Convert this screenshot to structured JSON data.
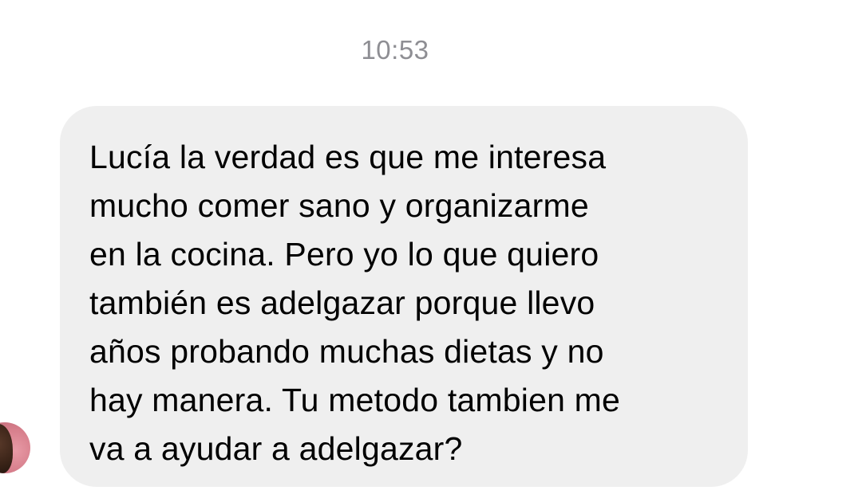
{
  "conversation": {
    "timestamp": "10:53",
    "messages": [
      {
        "sender_avatar": "contact-avatar",
        "text": "Lucía la verdad es que me interesa\nmucho comer sano y organizarme\nen la cocina. Pero yo lo que quiero\ntambién es adelgazar porque llevo\naños probando muchas dietas y no\nhay manera. Tu metodo tambien me\nva a ayudar a adelgazar?",
        "bubble_color": "#efefef"
      }
    ]
  }
}
